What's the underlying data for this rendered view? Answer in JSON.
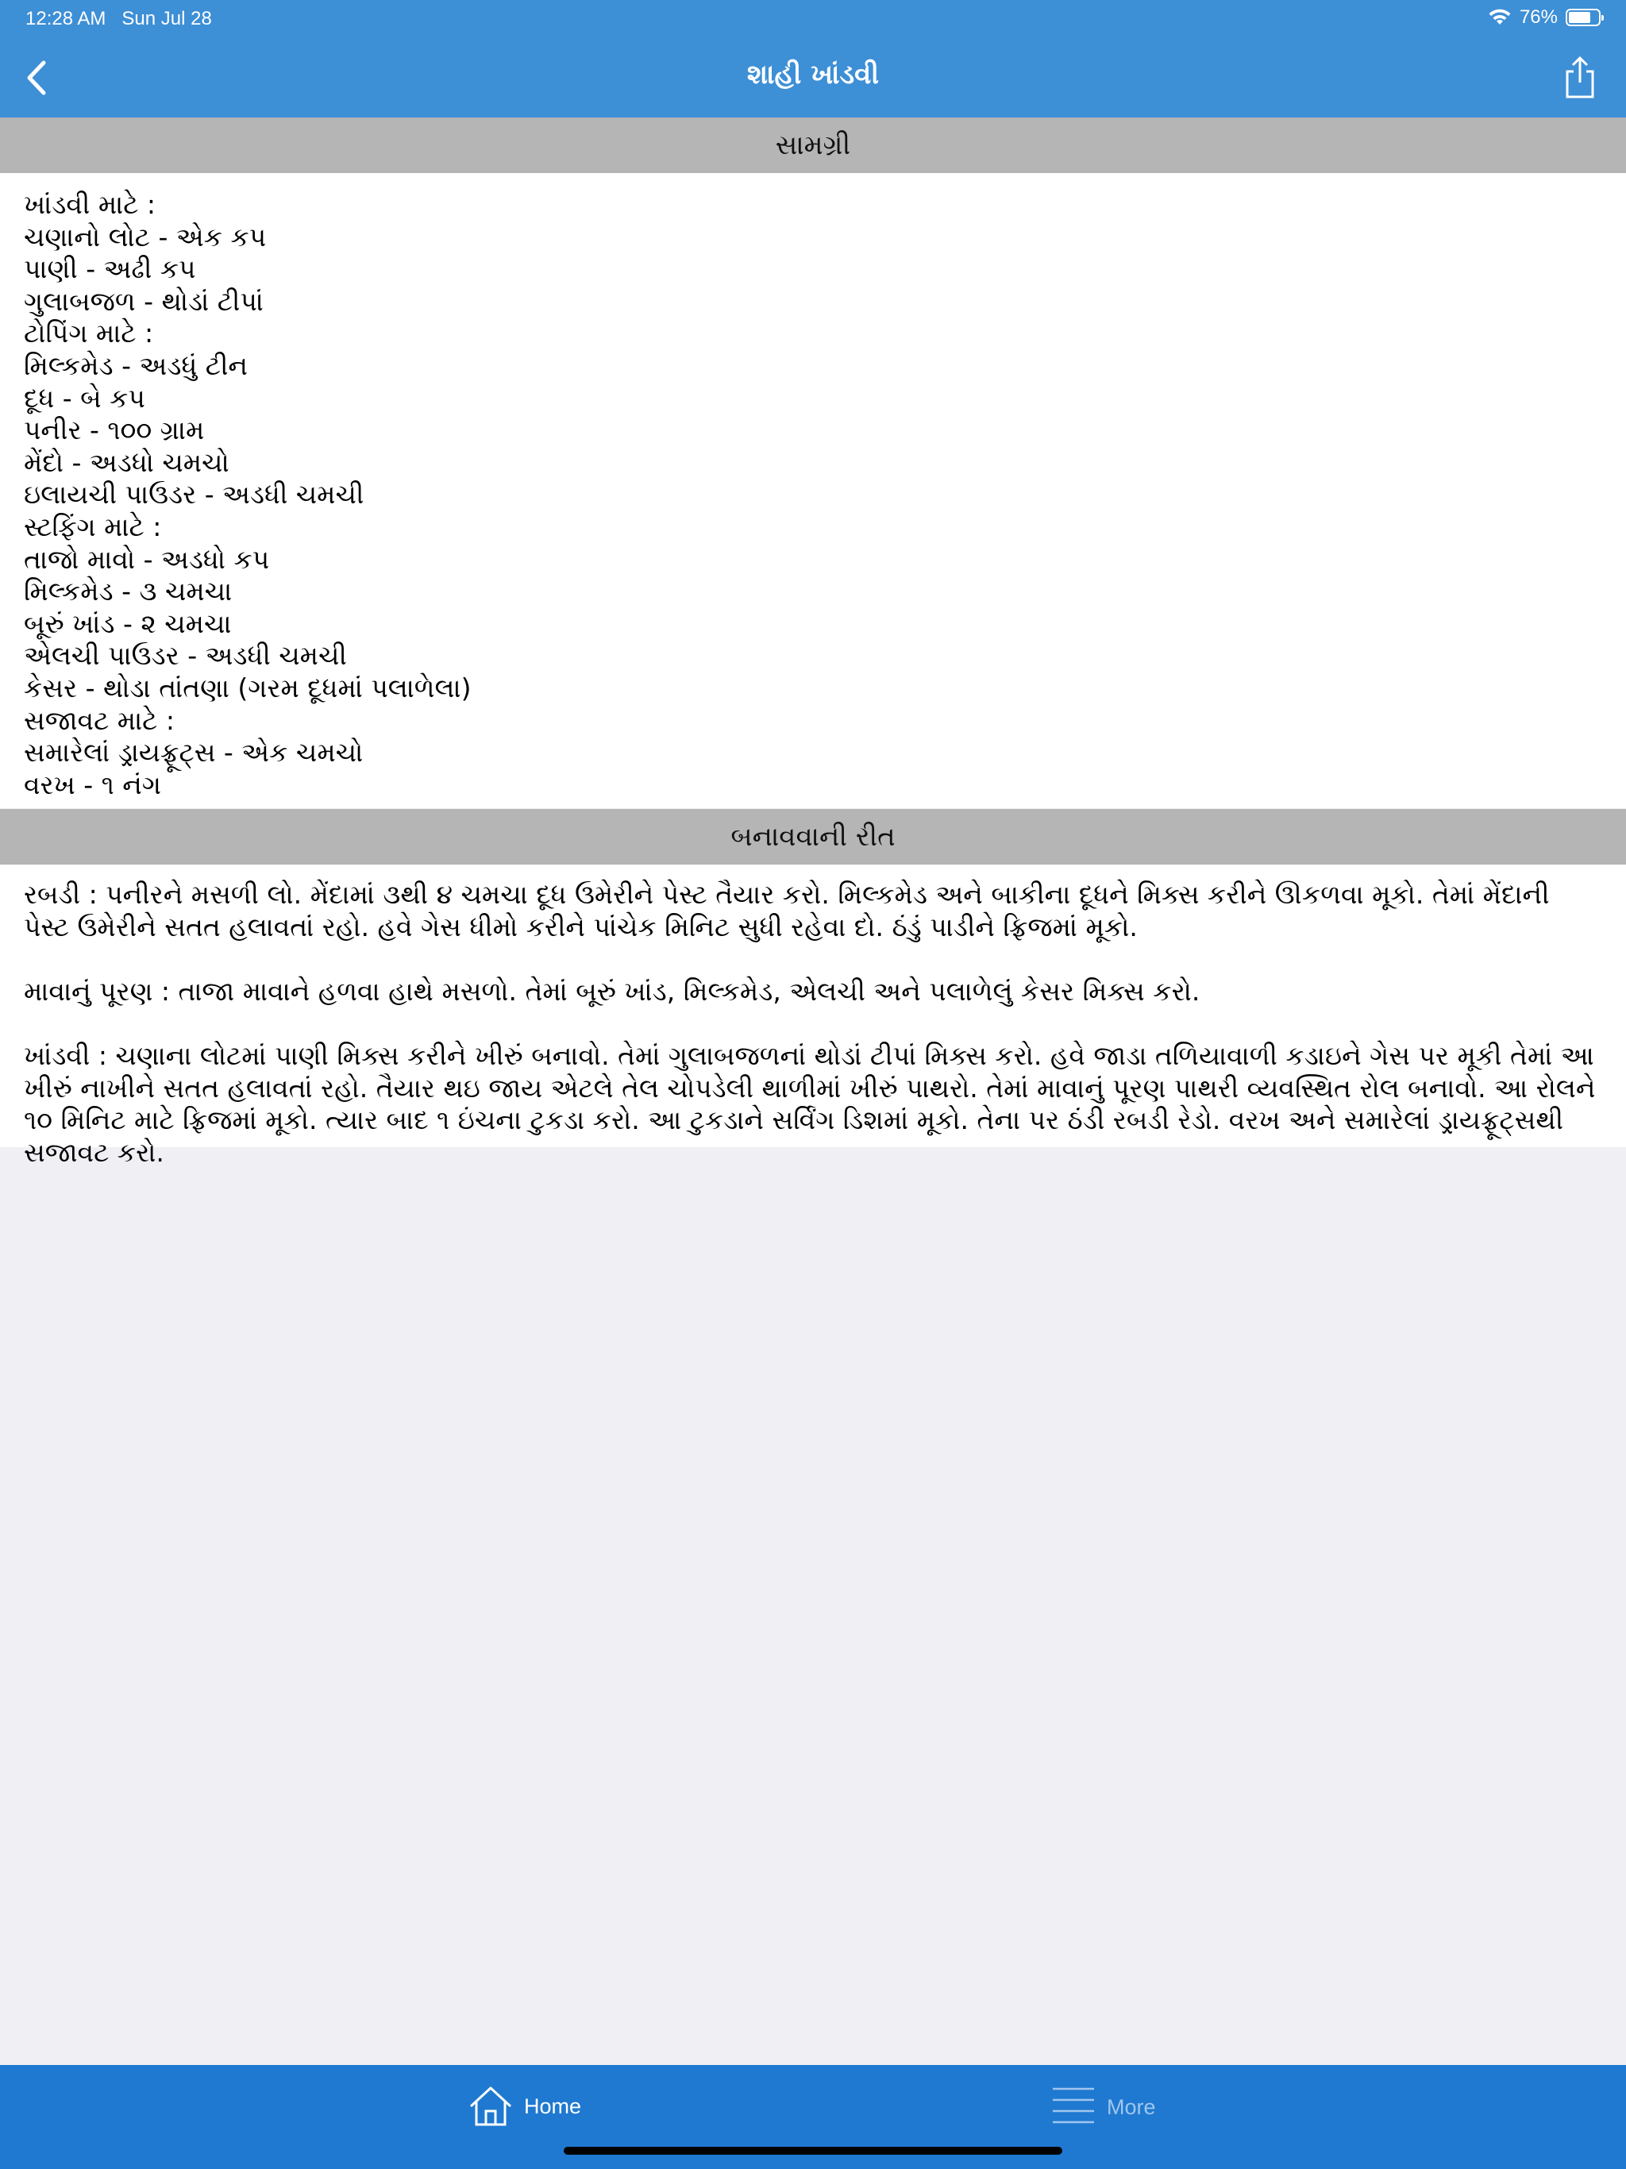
{
  "status_bar": {
    "time": "12:28 AM",
    "date": "Sun Jul 28",
    "battery_percent": "76%",
    "battery_level": 0.76,
    "wifi_icon": "wifi-icon",
    "battery_icon": "battery-icon"
  },
  "nav": {
    "title": "શાહી ખાંડવી",
    "back_icon": "chevron-left-icon",
    "share_icon": "share-icon"
  },
  "ingredients": {
    "header": "સામગ્રી",
    "lines": [
      "ખાંડવી માટે :",
      "ચણાનો લોટ - એક કપ",
      "પાણી - અઢી કપ",
      "ગુલાબજળ - થોડાં ટીપાં",
      "ટોપિંગ માટે :",
      "મિલ્કમેડ - અડધું ટીન",
      "દૂધ - બે કપ",
      "પનીર - ૧૦૦ ગ્રામ",
      "મેંદો - અડધો ચમચો",
      "ઇલાયચી પાઉડર - અડધી ચમચી",
      "સ્ટફિંગ માટે :",
      "તાજો માવો - અડધો કપ",
      "મિલ્કમેડ - ૩ ચમચા",
      "બૂરું ખાંડ - ૨ ચમચા",
      "એલચી પાઉડર - અડધી ચમચી",
      "કેસર - થોડા તાંતણા (ગરમ દૂધમાં પલાળેલા)",
      "સજાવટ માટે :",
      "સમારેલાં ડ્રાયફ્રૂટ્સ - એક ચમચો",
      "વરખ - ૧ નંગ"
    ]
  },
  "method": {
    "header": "બનાવવાની રીત",
    "paragraphs": [
      "રબડી : પનીરને મસળી લો. મેંદામાં ૩થી ૪ ચમચા દૂધ ઉમેરીને પેસ્ટ તૈયાર કરો. મિલ્કમેડ અને બાકીના દૂધને મિક્સ કરીને ઊકળવા મૂકો. તેમાં મેંદાની પેસ્ટ ઉમેરીને સતત હલાવતાં રહો. હવે ગેસ ધીમો કરીને પાંચેક મિનિટ સુધી રહેવા દો. ઠંડું પાડીને ફ્રિજમાં મૂકો.",
      "માવાનું પૂરણ : તાજા માવાને હળવા હાથે મસળો. તેમાં બૂરું ખાંડ, મિલ્કમેડ, એલચી અને પલાળેલું કેસર મિક્સ કરો.",
      "ખાંડવી : ચણાના લોટમાં પાણી મિક્સ કરીને ખીરું બનાવો. તેમાં ગુલાબજળનાં થોડાં ટીપાં મિક્સ કરો. હવે જાડા તળિયાવાળી કડાઇને ગેસ પર મૂકી તેમાં આ ખીરું નાખીને સતત હલાવતાં રહો. તૈયાર થઇ જાય એટલે તેલ ચોપડેલી થાળીમાં ખીરું પાથરો. તેમાં માવાનું પૂરણ પાથરી વ્યવસ્થિત રોલ બનાવો. આ રોલને ૧૦ મિનિટ માટે ફ્રિજમાં મૂકો. ત્યાર બાદ ૧ ઇંચના ટુકડા કરો. આ ટુકડાને સર્વિંગ ડિશમાં મૂકો. તેના પર ઠંડી રબડી રેડો. વરખ અને સમારેલાં ડ્રાયફ્રૂટ્સથી સજાવટ કરો."
    ]
  },
  "tab_bar": {
    "home_label": "Home",
    "more_label": "More",
    "home_icon": "home-icon",
    "more_icon": "menu-lines-icon",
    "active_color": "#ffffff",
    "inactive_color": "#9fc6ee",
    "background_color": "#1f79d0"
  },
  "colors": {
    "nav_background": "#3d8fd6",
    "section_header_background": "#b5b5b5",
    "page_background": "#efeff4"
  }
}
